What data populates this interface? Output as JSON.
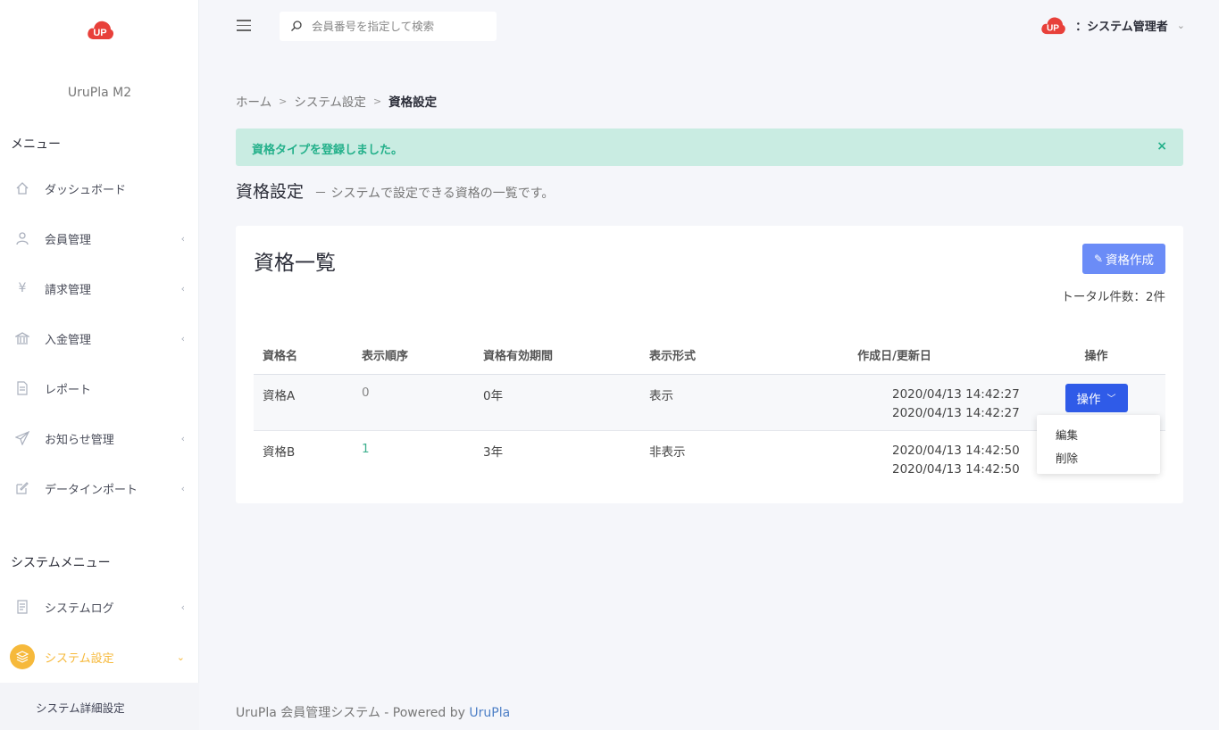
{
  "app": {
    "brand": "UruPla M2"
  },
  "colors": {
    "accent": "#f6b93b",
    "primary": "#2f5be8",
    "create_btn": "#6b8cf7",
    "alert_bg": "#c9ece2",
    "alert_text": "#23b08a"
  },
  "sidebar": {
    "menu_heading": "メニュー",
    "items": [
      {
        "label": "ダッシュボード",
        "icon": "home-icon",
        "has_chevron": false
      },
      {
        "label": "会員管理",
        "icon": "user-icon",
        "has_chevron": true
      },
      {
        "label": "請求管理",
        "icon": "yen-icon",
        "has_chevron": true
      },
      {
        "label": "入金管理",
        "icon": "bank-icon",
        "has_chevron": true
      },
      {
        "label": "レポート",
        "icon": "document-icon",
        "has_chevron": false
      },
      {
        "label": "お知らせ管理",
        "icon": "send-icon",
        "has_chevron": true
      },
      {
        "label": "データインポート",
        "icon": "edit-icon",
        "has_chevron": true
      }
    ],
    "system_heading": "システムメニュー",
    "system_items": [
      {
        "label": "システムログ",
        "icon": "log-icon",
        "has_chevron": true
      },
      {
        "label": "システム設定",
        "icon": "layers-icon",
        "has_chevron": true,
        "active": true
      }
    ],
    "sub_item": "システム詳細設定"
  },
  "topbar": {
    "search_placeholder": "会員番号を指定して検索",
    "user_name": "：システム管理者"
  },
  "breadcrumb": {
    "home": "ホーム",
    "sep": ">",
    "level1": "システム設定",
    "current": "資格設定"
  },
  "alert": {
    "message": "資格タイプを登録しました。",
    "close": "×"
  },
  "page": {
    "title": "資格設定",
    "subtitle": "－ システムで設定できる資格の一覧です。"
  },
  "card": {
    "title": "資格一覧",
    "create_button": "資格作成",
    "total": "トータル件数：2件",
    "columns": [
      "資格名",
      "表示順序",
      "資格有効期間",
      "表示形式",
      "作成日/更新日",
      "操作"
    ],
    "rows": [
      {
        "name": "資格A",
        "order": "0",
        "period": "0年",
        "display": "表示",
        "created": "2020/04/13 14:42:27",
        "updated": "2020/04/13 14:42:27"
      },
      {
        "name": "資格B",
        "order": "1",
        "period": "3年",
        "display": "非表示",
        "created": "2020/04/13 14:42:50",
        "updated": "2020/04/13 14:42:50"
      }
    ],
    "op_button": "操作",
    "dropdown": [
      "編集",
      "削除"
    ]
  },
  "footer": {
    "text": "UruPla 会員管理システム - Powered by ",
    "link": "UruPla"
  }
}
